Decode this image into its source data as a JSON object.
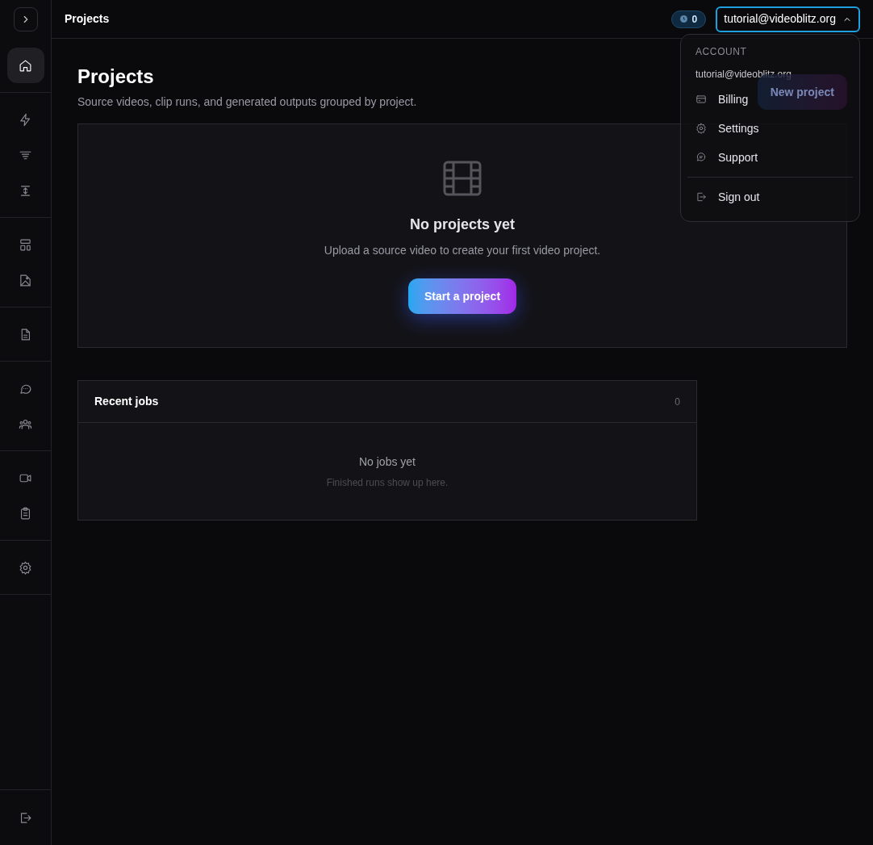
{
  "sidebar": {
    "toggle_expanded": false,
    "groups": [
      [
        {
          "kind": "home",
          "selected": true
        }
      ],
      [
        {
          "kind": "zap",
          "selected": false
        },
        {
          "kind": "filter",
          "selected": false
        },
        {
          "kind": "split",
          "selected": false
        }
      ],
      [
        {
          "kind": "layout",
          "selected": false
        },
        {
          "kind": "image-file",
          "selected": false
        }
      ],
      [
        {
          "kind": "file",
          "selected": false
        }
      ],
      [
        {
          "kind": "chat",
          "selected": false
        },
        {
          "kind": "users",
          "selected": false
        }
      ],
      [
        {
          "kind": "video",
          "selected": false
        },
        {
          "kind": "clipboard",
          "selected": false
        }
      ],
      [
        {
          "kind": "settings",
          "selected": false
        }
      ]
    ],
    "footer": [
      {
        "kind": "signout",
        "selected": false
      }
    ]
  },
  "topbar": {
    "title": "Projects",
    "credits": "0",
    "account": {
      "label": "tutorial@videoblitz.org",
      "expanded": true
    }
  },
  "page": {
    "heading": "Projects",
    "subtitle": "Source videos, clip runs, and generated outputs grouped by project.",
    "new_button": "New project"
  },
  "empty_state": {
    "title": "No projects yet",
    "text": "Upload a source video to create your first video project.",
    "button": "Start a project"
  },
  "recent_jobs": {
    "title": "Recent jobs",
    "count": "0",
    "empty_title": "No jobs yet",
    "empty_text": "Finished runs show up here."
  },
  "account_menu": {
    "section": "ACCOUNT",
    "email": "tutorial@videoblitz.org",
    "items": [
      {
        "kind": "billing",
        "label": "Billing"
      },
      {
        "kind": "settings",
        "label": "Settings"
      },
      {
        "kind": "support",
        "label": "Support"
      },
      {
        "kind": "divider"
      },
      {
        "kind": "signout",
        "label": "Sign out"
      }
    ]
  }
}
